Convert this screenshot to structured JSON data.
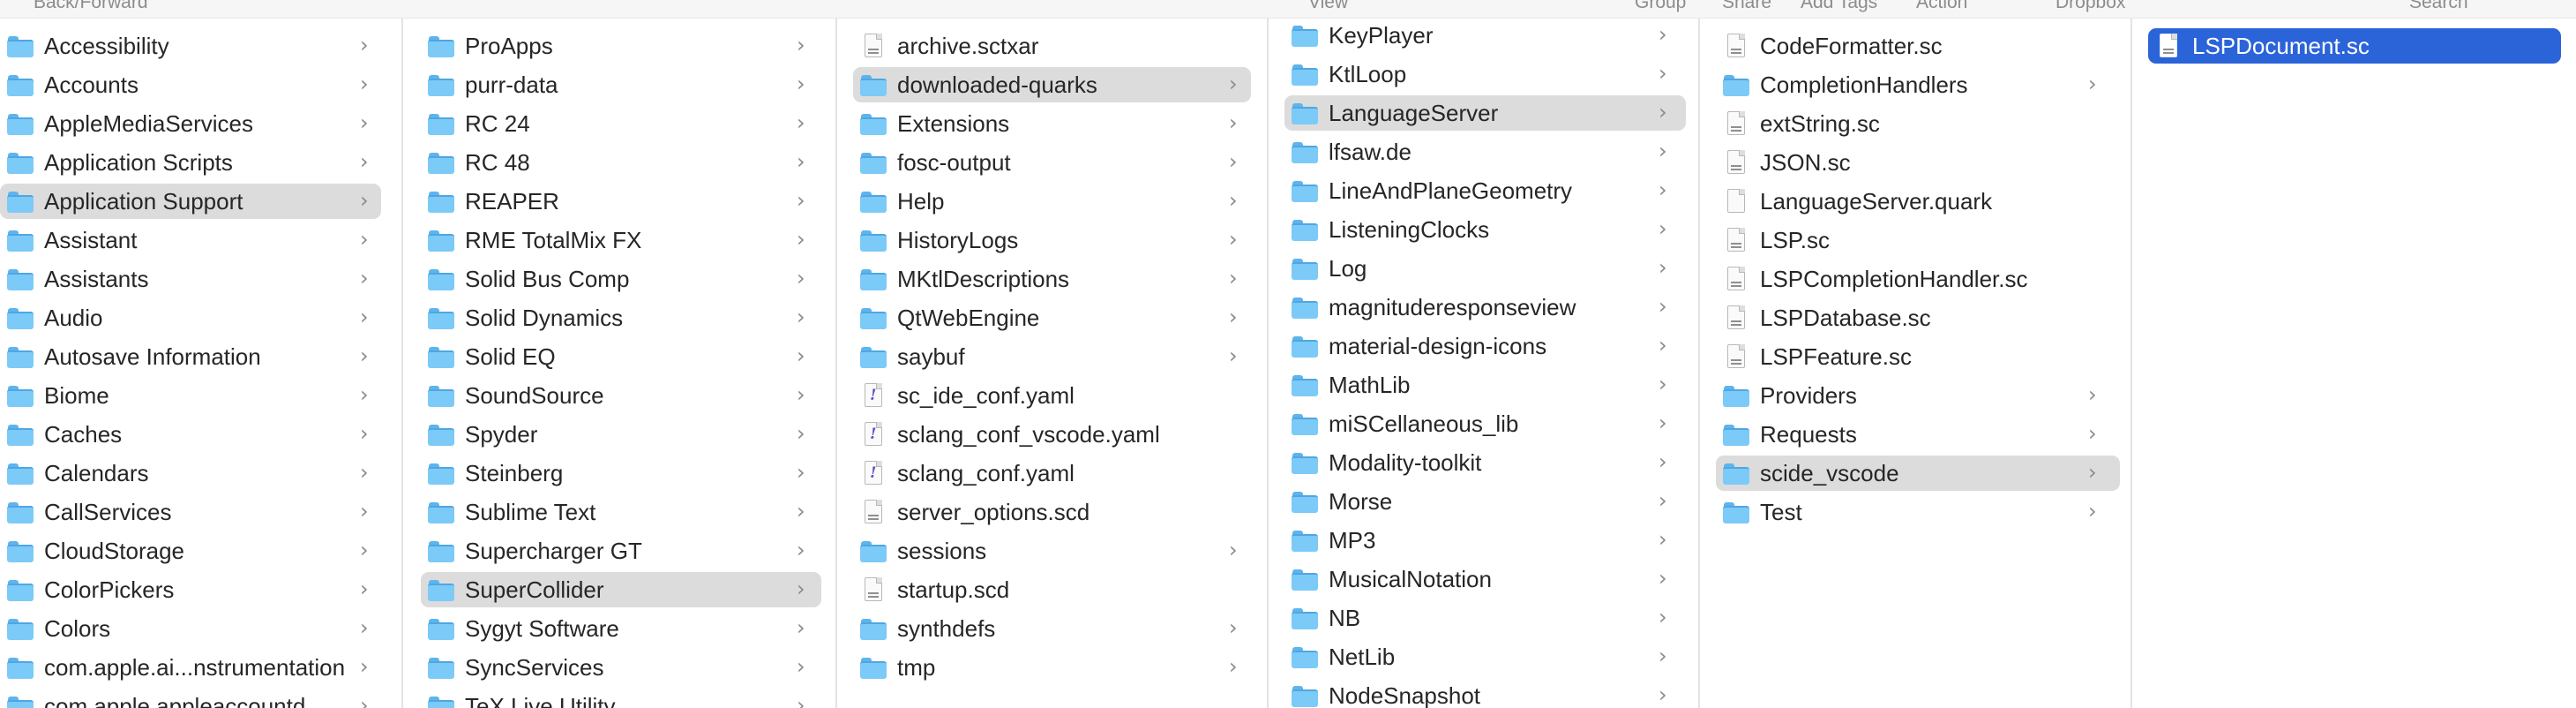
{
  "toolbar": {
    "labels": [
      "Back/Forward",
      "View",
      "Group",
      "Share",
      "Add Tags",
      "Action",
      "Dropbox",
      "Search"
    ]
  },
  "columns": [
    {
      "items": [
        {
          "name": "Accessibility",
          "kind": "folder",
          "chevron": true
        },
        {
          "name": "Accounts",
          "kind": "folder",
          "chevron": true
        },
        {
          "name": "AppleMediaServices",
          "kind": "folder",
          "chevron": true
        },
        {
          "name": "Application Scripts",
          "kind": "folder",
          "chevron": true
        },
        {
          "name": "Application Support",
          "kind": "folder",
          "chevron": true,
          "selected": "gray"
        },
        {
          "name": "Assistant",
          "kind": "folder",
          "chevron": true
        },
        {
          "name": "Assistants",
          "kind": "folder",
          "chevron": true
        },
        {
          "name": "Audio",
          "kind": "folder",
          "chevron": true
        },
        {
          "name": "Autosave Information",
          "kind": "folder",
          "chevron": true
        },
        {
          "name": "Biome",
          "kind": "folder",
          "chevron": true
        },
        {
          "name": "Caches",
          "kind": "folder",
          "chevron": true
        },
        {
          "name": "Calendars",
          "kind": "folder",
          "chevron": true
        },
        {
          "name": "CallServices",
          "kind": "folder",
          "chevron": true
        },
        {
          "name": "CloudStorage",
          "kind": "folder",
          "chevron": true
        },
        {
          "name": "ColorPickers",
          "kind": "folder",
          "chevron": true
        },
        {
          "name": "Colors",
          "kind": "folder",
          "chevron": true
        },
        {
          "name": "com.apple.ai...nstrumentation",
          "kind": "folder",
          "chevron": true
        },
        {
          "name": "com.apple.appleaccountd",
          "kind": "folder",
          "chevron": true
        }
      ]
    },
    {
      "items": [
        {
          "name": "ProApps",
          "kind": "folder",
          "chevron": true
        },
        {
          "name": "purr-data",
          "kind": "folder",
          "chevron": true
        },
        {
          "name": "RC 24",
          "kind": "folder",
          "chevron": true
        },
        {
          "name": "RC 48",
          "kind": "folder",
          "chevron": true
        },
        {
          "name": "REAPER",
          "kind": "folder",
          "chevron": true
        },
        {
          "name": "RME TotalMix FX",
          "kind": "folder",
          "chevron": true
        },
        {
          "name": "Solid Bus Comp",
          "kind": "folder",
          "chevron": true
        },
        {
          "name": "Solid Dynamics",
          "kind": "folder",
          "chevron": true
        },
        {
          "name": "Solid EQ",
          "kind": "folder",
          "chevron": true
        },
        {
          "name": "SoundSource",
          "kind": "folder",
          "chevron": true
        },
        {
          "name": "Spyder",
          "kind": "folder",
          "chevron": true
        },
        {
          "name": "Steinberg",
          "kind": "folder",
          "chevron": true
        },
        {
          "name": "Sublime Text",
          "kind": "folder",
          "chevron": true
        },
        {
          "name": "Supercharger GT",
          "kind": "folder",
          "chevron": true
        },
        {
          "name": "SuperCollider",
          "kind": "folder",
          "chevron": true,
          "selected": "gray"
        },
        {
          "name": "Sygyt Software",
          "kind": "folder",
          "chevron": true
        },
        {
          "name": "SyncServices",
          "kind": "folder",
          "chevron": true
        },
        {
          "name": "TeX Live Utility",
          "kind": "folder",
          "chevron": true
        }
      ]
    },
    {
      "items": [
        {
          "name": "archive.sctxar",
          "kind": "file",
          "chevron": false
        },
        {
          "name": "downloaded-quarks",
          "kind": "folder",
          "chevron": true,
          "selected": "gray"
        },
        {
          "name": "Extensions",
          "kind": "folder",
          "chevron": true
        },
        {
          "name": "fosc-output",
          "kind": "folder",
          "chevron": true
        },
        {
          "name": "Help",
          "kind": "folder",
          "chevron": true
        },
        {
          "name": "HistoryLogs",
          "kind": "folder",
          "chevron": true
        },
        {
          "name": "MKtlDescriptions",
          "kind": "folder",
          "chevron": true
        },
        {
          "name": "QtWebEngine",
          "kind": "folder",
          "chevron": true
        },
        {
          "name": "saybuf",
          "kind": "folder",
          "chevron": true
        },
        {
          "name": "sc_ide_conf.yaml",
          "kind": "yaml",
          "chevron": false
        },
        {
          "name": "sclang_conf_vscode.yaml",
          "kind": "yaml",
          "chevron": false
        },
        {
          "name": "sclang_conf.yaml",
          "kind": "yaml",
          "chevron": false
        },
        {
          "name": "server_options.scd",
          "kind": "file",
          "chevron": false
        },
        {
          "name": "sessions",
          "kind": "folder",
          "chevron": true
        },
        {
          "name": "startup.scd",
          "kind": "file",
          "chevron": false
        },
        {
          "name": "synthdefs",
          "kind": "folder",
          "chevron": true
        },
        {
          "name": "tmp",
          "kind": "folder",
          "chevron": true
        }
      ]
    },
    {
      "items": [
        {
          "name": "KeyPlayer",
          "kind": "folder",
          "chevron": true
        },
        {
          "name": "KtlLoop",
          "kind": "folder",
          "chevron": true
        },
        {
          "name": "LanguageServer",
          "kind": "folder",
          "chevron": true,
          "selected": "gray"
        },
        {
          "name": "lfsaw.de",
          "kind": "folder",
          "chevron": true
        },
        {
          "name": "LineAndPlaneGeometry",
          "kind": "folder",
          "chevron": true
        },
        {
          "name": "ListeningClocks",
          "kind": "folder",
          "chevron": true
        },
        {
          "name": "Log",
          "kind": "folder",
          "chevron": true
        },
        {
          "name": "magnituderesponseview",
          "kind": "folder",
          "chevron": true
        },
        {
          "name": "material-design-icons",
          "kind": "folder",
          "chevron": true
        },
        {
          "name": "MathLib",
          "kind": "folder",
          "chevron": true
        },
        {
          "name": "miSCellaneous_lib",
          "kind": "folder",
          "chevron": true
        },
        {
          "name": "Modality-toolkit",
          "kind": "folder",
          "chevron": true
        },
        {
          "name": "Morse",
          "kind": "folder",
          "chevron": true
        },
        {
          "name": "MP3",
          "kind": "folder",
          "chevron": true
        },
        {
          "name": "MusicalNotation",
          "kind": "folder",
          "chevron": true
        },
        {
          "name": "NB",
          "kind": "folder",
          "chevron": true
        },
        {
          "name": "NetLib",
          "kind": "folder",
          "chevron": true
        },
        {
          "name": "NodeSnapshot",
          "kind": "folder",
          "chevron": true
        }
      ]
    },
    {
      "items": [
        {
          "name": "CodeFormatter.sc",
          "kind": "file",
          "chevron": false
        },
        {
          "name": "CompletionHandlers",
          "kind": "folder",
          "chevron": true
        },
        {
          "name": "extString.sc",
          "kind": "file",
          "chevron": false
        },
        {
          "name": "JSON.sc",
          "kind": "file",
          "chevron": false
        },
        {
          "name": "LanguageServer.quark",
          "kind": "blank",
          "chevron": false
        },
        {
          "name": "LSP.sc",
          "kind": "file",
          "chevron": false
        },
        {
          "name": "LSPCompletionHandler.sc",
          "kind": "file",
          "chevron": false
        },
        {
          "name": "LSPDatabase.sc",
          "kind": "file",
          "chevron": false
        },
        {
          "name": "LSPFeature.sc",
          "kind": "file",
          "chevron": false
        },
        {
          "name": "Providers",
          "kind": "folder",
          "chevron": true
        },
        {
          "name": "Requests",
          "kind": "folder",
          "chevron": true
        },
        {
          "name": "scide_vscode",
          "kind": "folder",
          "chevron": true,
          "selected": "gray"
        },
        {
          "name": "Test",
          "kind": "folder",
          "chevron": true
        }
      ]
    },
    {
      "items": [
        {
          "name": "LSPDocument.sc",
          "kind": "file",
          "chevron": false,
          "selected": "blue"
        }
      ]
    }
  ],
  "chevron_glyph": "›"
}
